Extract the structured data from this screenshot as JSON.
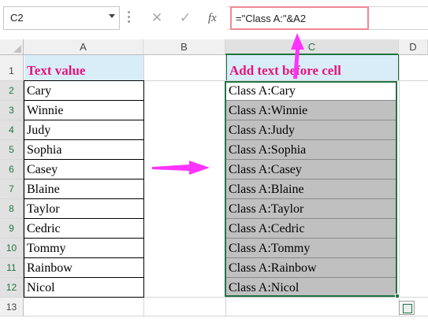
{
  "name_box": "C2",
  "formula": "=\"Class A:\"&A2",
  "fx_label": "fx",
  "columns": [
    "A",
    "B",
    "C",
    "D"
  ],
  "rows": [
    "1",
    "2",
    "3",
    "4",
    "5",
    "6",
    "7",
    "8",
    "9",
    "10",
    "11",
    "12",
    "13"
  ],
  "colA_header": "Text value",
  "colC_header": "Add text before cell",
  "colA": [
    "Cary",
    "Winnie",
    "Judy",
    "Sophia",
    "Casey",
    "Blaine",
    "Taylor",
    "Cedric",
    "Tommy",
    "Rainbow",
    "Nicol"
  ],
  "colC": [
    "Class A:Cary",
    "Class A:Winnie",
    "Class A:Judy",
    "Class A:Sophia",
    "Class A:Casey",
    "Class A:Blaine",
    "Class A:Taylor",
    "Class A:Cedric",
    "Class A:Tommy",
    "Class A:Rainbow",
    "Class A:Nicol"
  ],
  "colors": {
    "accent": "#e8137c",
    "header_fill": "#d9edf8",
    "selection": "#217346",
    "result_fill": "#c0c0c0",
    "arrow": "#ff33ff"
  },
  "icons": {
    "cancel": "cancel-icon",
    "enter": "checkmark-icon",
    "function": "insert-function-icon"
  }
}
